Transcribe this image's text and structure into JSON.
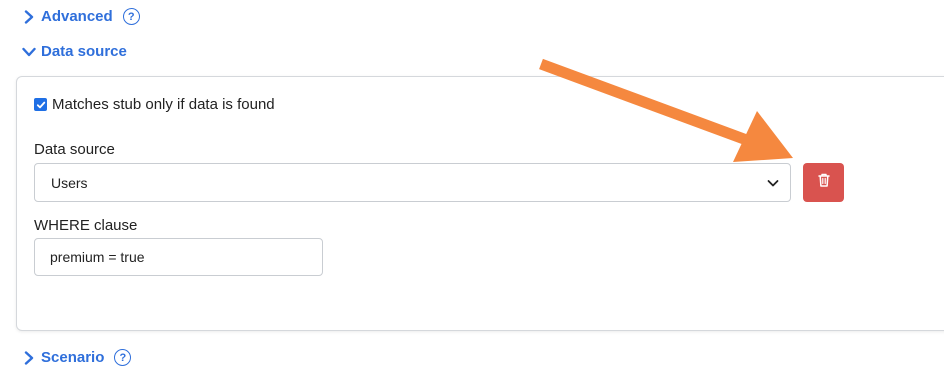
{
  "sections": {
    "advanced": {
      "label": "Advanced",
      "help": "?"
    },
    "data_source": {
      "label": "Data source"
    },
    "scenario": {
      "label": "Scenario",
      "help": "?"
    }
  },
  "panel": {
    "checkbox": {
      "label": "Matches stub only if data is found",
      "checked": true
    },
    "data_source_field": {
      "label": "Data source",
      "selected": "Users"
    },
    "where_field": {
      "label": "WHERE clause",
      "value": "premium = true"
    },
    "delete_button": {
      "icon": "trash-icon"
    }
  },
  "annotation": {
    "arrow_color": "#f5883f"
  },
  "colors": {
    "link": "#2f6fdb",
    "danger": "#d9534f",
    "checkbox": "#1f6fe5"
  }
}
